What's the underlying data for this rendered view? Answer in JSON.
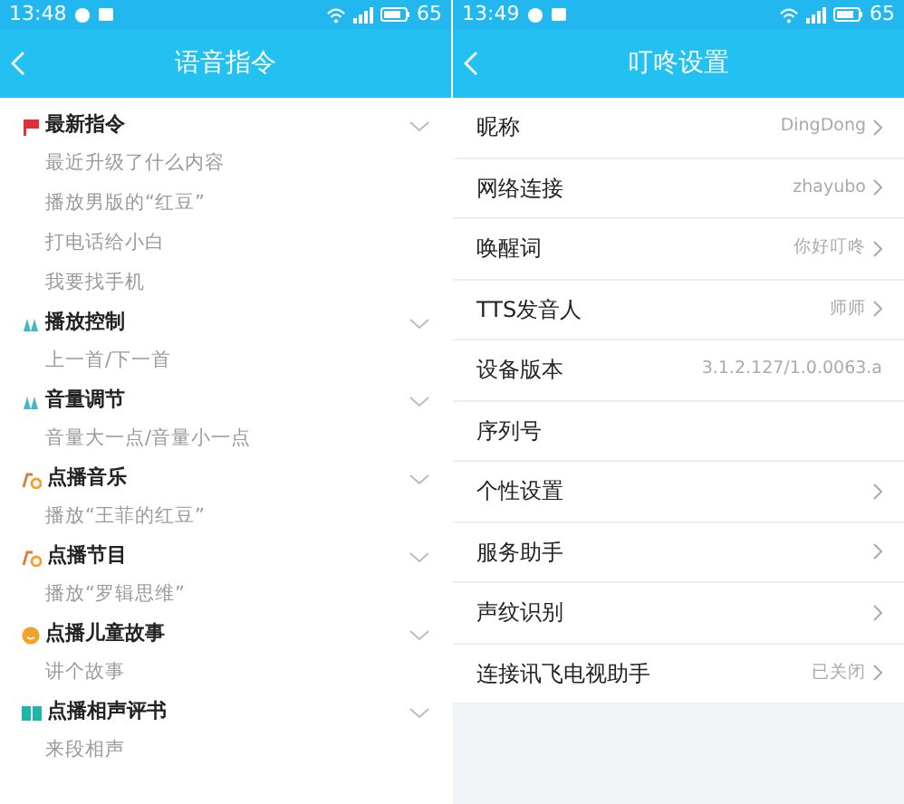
{
  "screens": [
    {
      "status_bar": {
        "time": "13:48",
        "battery": "65"
      },
      "header": {
        "title": "语音指令"
      },
      "categories": [
        {
          "kind": "flag",
          "title": "最新指令",
          "expanded": true,
          "items": [
            "最近升级了什么内容",
            "播放男版的“红豆”",
            "打电话给小白",
            "我要找手机"
          ]
        },
        {
          "kind": "hands",
          "title": "播放控制",
          "expanded": true,
          "items": [
            "上一首/下一首"
          ]
        },
        {
          "kind": "hands",
          "title": "音量调节",
          "expanded": true,
          "items": [
            "音量大一点/音量小一点"
          ]
        },
        {
          "kind": "note",
          "title": "点播音乐",
          "expanded": true,
          "items": [
            "播放“王菲的红豆”"
          ]
        },
        {
          "kind": "note",
          "title": "点播节目",
          "expanded": true,
          "items": [
            "播放“罗辑思维”"
          ]
        },
        {
          "kind": "face",
          "title": "点播儿童故事",
          "expanded": true,
          "items": [
            "讲个故事"
          ]
        },
        {
          "kind": "book",
          "title": "点播相声评书",
          "expanded": true,
          "items": [
            "来段相声"
          ]
        }
      ]
    },
    {
      "status_bar": {
        "time": "13:49",
        "battery": "65"
      },
      "header": {
        "title": "叮咚设置"
      },
      "settings": [
        {
          "label": "昵称",
          "value": "DingDong",
          "chevron": true
        },
        {
          "label": "网络连接",
          "value": "zhayubo",
          "chevron": true
        },
        {
          "label": "唤醒词",
          "value": "你好叮咚",
          "chevron": true
        },
        {
          "label": "TTS发音人",
          "value": "师师",
          "chevron": true
        },
        {
          "label": "设备版本",
          "value": "3.1.2.127/1.0.0063.a",
          "chevron": false
        },
        {
          "label": "序列号",
          "chevron": false
        },
        {
          "label": "个性设置",
          "chevron": true
        },
        {
          "label": "服务助手",
          "chevron": true
        },
        {
          "label": "声纹识别",
          "chevron": true
        },
        {
          "label": "连接讯飞电视助手",
          "value": "已关闭",
          "chevron": true
        }
      ]
    }
  ]
}
